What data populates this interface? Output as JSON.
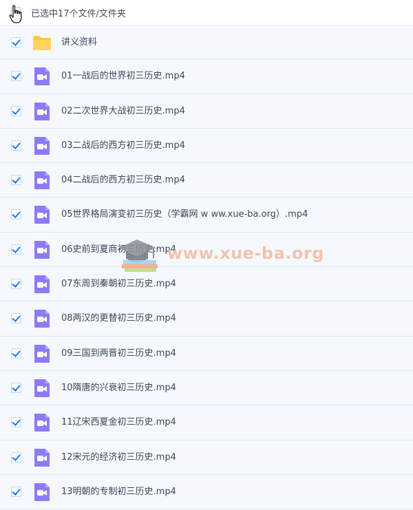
{
  "header": {
    "selection_text": "已选中17个文件/文件夹"
  },
  "files": [
    {
      "name": "讲义资料",
      "type": "folder-icon"
    },
    {
      "name": "01一战后的世界初三历史.mp4",
      "type": "video-icon"
    },
    {
      "name": "02二次世界大战初三历史.mp4",
      "type": "video-icon"
    },
    {
      "name": "03二战后的西方初三历史.mp4",
      "type": "video-icon"
    },
    {
      "name": "04二战后的西方初三历史.mp4",
      "type": "video-icon"
    },
    {
      "name": "05世界格局演变初三历史（学霸网 w ww.xue-ba.org）.mp4",
      "type": "video-icon"
    },
    {
      "name": "06史前到夏商初三历史.mp4",
      "type": "video-icon"
    },
    {
      "name": "07东周到秦朝初三历史.mp4",
      "type": "video-icon"
    },
    {
      "name": "08两汉的更替初三历史.mp4",
      "type": "video-icon"
    },
    {
      "name": "09三国到两晋初三历史.mp4",
      "type": "video-icon"
    },
    {
      "name": "10隋唐的兴衰初三历史.mp4",
      "type": "video-icon"
    },
    {
      "name": "11辽宋西夏金初三历史.mp4",
      "type": "video-icon"
    },
    {
      "name": "12宋元的经济初三历史.mp4",
      "type": "video-icon"
    },
    {
      "name": "13明朝的专制初三历史.mp4",
      "type": "video-icon"
    }
  ],
  "watermark": {
    "text": "www.xue-ba.org"
  },
  "colors": {
    "row_bg": "#f5f9fe",
    "check": "#1f7ae8",
    "video_icon": "#8b7cf6",
    "folder_icon": "#ffc83d",
    "watermark": "#f4b9a3"
  }
}
